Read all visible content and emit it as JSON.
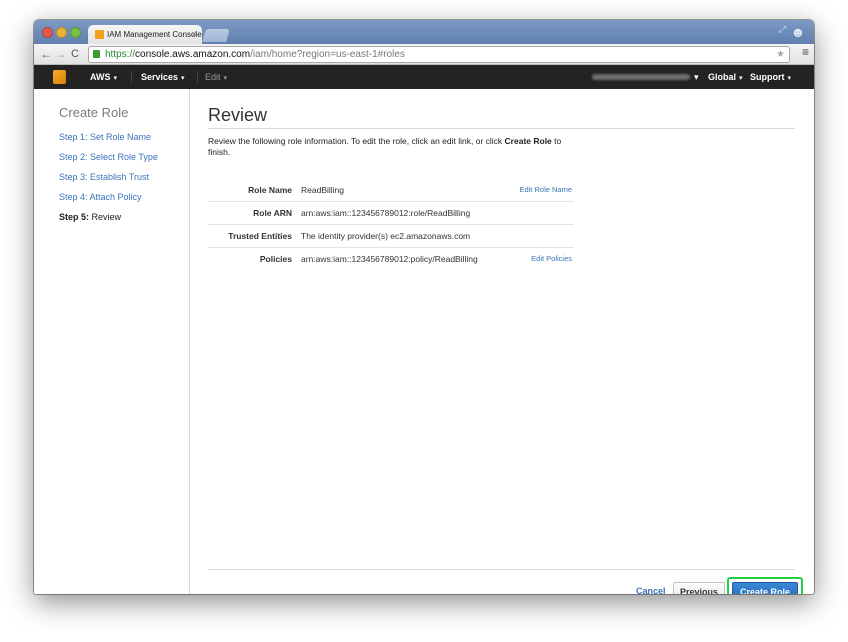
{
  "browser": {
    "tab_title": "IAM Management Console",
    "tab_close": "×",
    "url_scheme": "https://",
    "url_host": "console.aws.amazon.com",
    "url_path": "/iam/home?region=us-east-1#roles",
    "back_icon": "←",
    "forward_icon": "→",
    "reload_icon": "C",
    "star_icon": "★",
    "menu_icon": "≡"
  },
  "aws_nav": {
    "aws_label": "AWS",
    "services_label": "Services",
    "edit_label": "Edit",
    "global_label": "Global",
    "support_label": "Support",
    "caret": "▾"
  },
  "sidebar": {
    "title": "Create Role",
    "steps": [
      "Step 1: Set Role Name",
      "Step 2: Select Role Type",
      "Step 3: Establish Trust",
      "Step 4: Attach Policy"
    ],
    "current_step_prefix": "Step 5:",
    "current_step_label": " Review"
  },
  "main": {
    "title": "Review",
    "intro_before": "Review the following role information. To edit the role, click an edit link, or click ",
    "intro_bold": "Create Role",
    "intro_after": " to finish.",
    "rows": [
      {
        "label": "Role Name",
        "value": "ReadBilling",
        "edit": "Edit Role Name"
      },
      {
        "label": "Role ARN",
        "value": "arn:aws:iam::123456789012:role/ReadBilling",
        "edit": ""
      },
      {
        "label": "Trusted Entities",
        "value": "The identity provider(s) ec2.amazonaws.com",
        "edit": ""
      },
      {
        "label": "Policies",
        "value": "arn:aws:iam::123456789012:policy/ReadBilling",
        "edit": "Edit Policies"
      }
    ]
  },
  "footer": {
    "cancel": "Cancel",
    "previous": "Previous",
    "create_role": "Create Role"
  },
  "colors": {
    "link_blue": "#3b73b9",
    "primary_button": "#2a75c4",
    "highlight_green": "#23d146",
    "nav_background": "#232323"
  }
}
